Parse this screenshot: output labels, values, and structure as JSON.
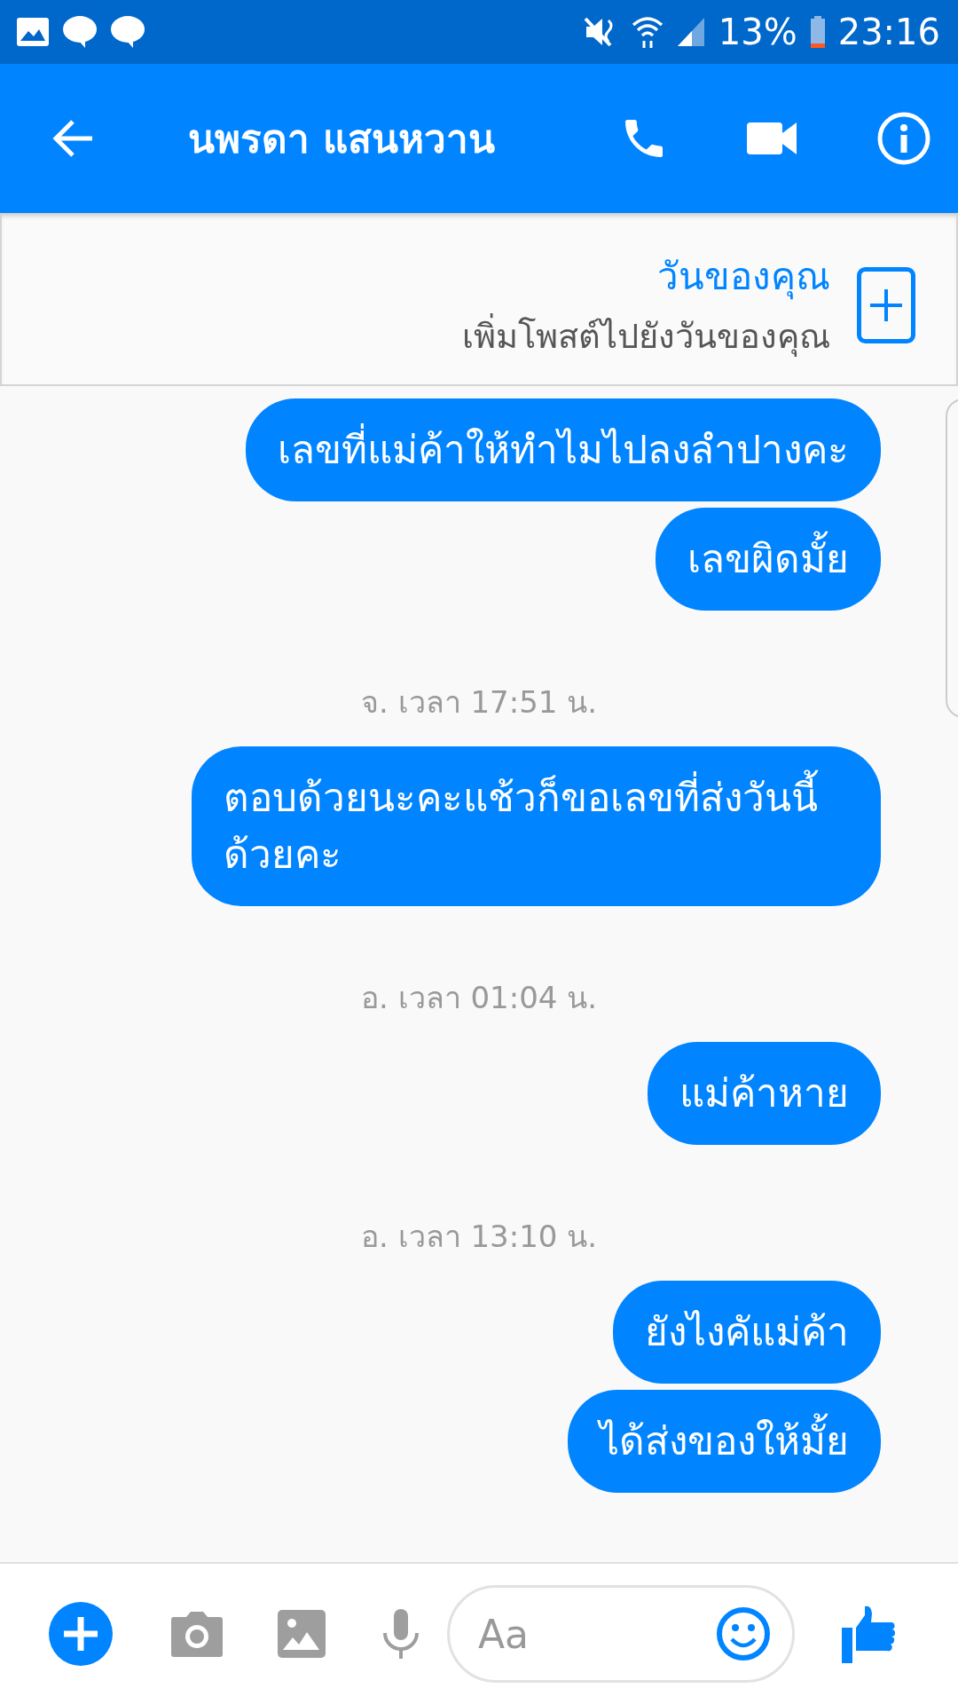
{
  "status_bar": {
    "battery": "13%",
    "time": "23:16"
  },
  "header": {
    "title": "นพรดา แสนหวาน"
  },
  "story_banner": {
    "title": "วันของคุณ",
    "subtitle": "เพิ่มโพสต์ไปยังวันของคุณ"
  },
  "messages": [
    {
      "kind": "bubble",
      "text": "เลขที่แม่ค้าให้ทำไมไปลงลำปางคะ"
    },
    {
      "kind": "bubble",
      "text": "เลขผิดมั้ย"
    },
    {
      "kind": "timestamp",
      "text": "จ. เวลา 17:51 น."
    },
    {
      "kind": "bubble",
      "text": "ตอบด้วยนะคะแช้วก็ขอเลขที่ส่งวันนี้ด้วยคะ"
    },
    {
      "kind": "timestamp",
      "text": "อ. เวลา 01:04 น."
    },
    {
      "kind": "bubble",
      "text": "แม่ค้าหาย"
    },
    {
      "kind": "timestamp",
      "text": "อ. เวลา 13:10 น."
    },
    {
      "kind": "bubble",
      "text": "ยังไงคัแม่ค้า"
    },
    {
      "kind": "bubble",
      "text": "ได้ส่งของให้มั้ย"
    }
  ],
  "composer": {
    "placeholder": "Aa"
  }
}
